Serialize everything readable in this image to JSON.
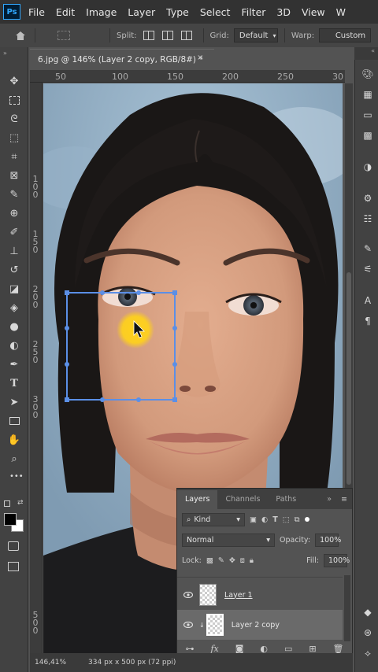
{
  "app": {
    "logo": "Ps"
  },
  "menu": [
    "File",
    "Edit",
    "Image",
    "Layer",
    "Type",
    "Select",
    "Filter",
    "3D",
    "View",
    "W"
  ],
  "options_bar": {
    "split_label": "Split:",
    "grid_label": "Grid:",
    "grid_value": "Default",
    "warp_label": "Warp:",
    "warp_value": "Custom"
  },
  "document": {
    "tab_title": "6.jpg @ 146% (Layer 2 copy, RGB/8#) *",
    "close": "×"
  },
  "rulers": {
    "horizontal": [
      "50",
      "100",
      "150",
      "200",
      "250",
      "30"
    ],
    "vertical": [
      "1 0 0",
      "1 5 0",
      "2 0 0",
      "2 5 0",
      "3 0 0",
      "5 0 0"
    ]
  },
  "tools": [
    "move-icon",
    "marquee-icon",
    "lasso-icon",
    "quick-select-icon",
    "crop-icon",
    "frame-icon",
    "eyedropper-icon",
    "healing-brush-icon",
    "brush-icon",
    "clone-stamp-icon",
    "history-brush-icon",
    "eraser-icon",
    "paint-bucket-icon",
    "blur-icon",
    "dodge-icon",
    "pen-icon",
    "type-icon",
    "path-select-icon",
    "rectangle-icon",
    "hand-icon",
    "zoom-icon"
  ],
  "layers_panel": {
    "tabs": [
      "Layers",
      "Channels",
      "Paths"
    ],
    "active_tab": "Layers",
    "filter_kind": "Kind",
    "blend_mode": "Normal",
    "opacity_label": "Opacity:",
    "opacity_value": "100%",
    "lock_label": "Lock:",
    "fill_label": "Fill:",
    "fill_value": "100%",
    "layers": [
      {
        "name": "Layer 1",
        "visible": true,
        "selected": false
      },
      {
        "name": "Layer 2 copy",
        "visible": true,
        "selected": true
      }
    ]
  },
  "status": {
    "zoom": "146,41%",
    "doc_size": "334 px x 500 px (72 ppi)"
  },
  "colors": {
    "menubar": "#323232",
    "panel": "#535353",
    "accent": "#31a8ff",
    "transform_box": "#5b8fe6",
    "cursor_highlight": "#ffd21a"
  }
}
